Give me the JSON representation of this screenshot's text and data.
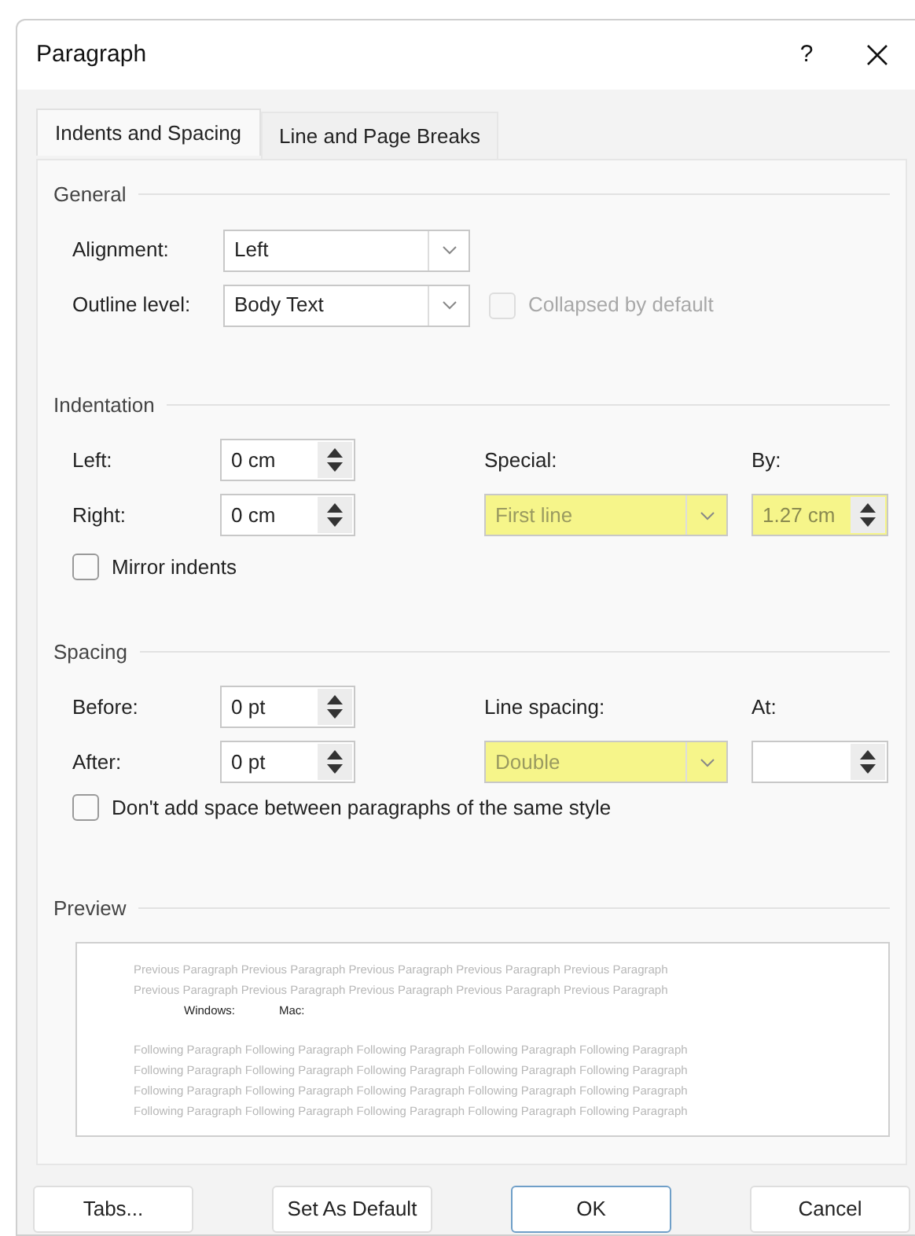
{
  "window": {
    "title": "Paragraph",
    "help": "?"
  },
  "tabs": [
    {
      "label": "Indents and Spacing",
      "selected": true
    },
    {
      "label": "Line and Page Breaks",
      "selected": false
    }
  ],
  "general": {
    "title": "General",
    "alignment": {
      "label": "Alignment:",
      "value": "Left"
    },
    "outline_level": {
      "label": "Outline level:",
      "value": "Body Text"
    },
    "collapsed": {
      "label": "Collapsed by default",
      "checked": false,
      "disabled": true
    }
  },
  "indentation": {
    "title": "Indentation",
    "left": {
      "label": "Left:",
      "value": "0 cm"
    },
    "right": {
      "label": "Right:",
      "value": "0 cm"
    },
    "special": {
      "label": "Special:",
      "value": "First line",
      "highlighted": true
    },
    "by": {
      "label": "By:",
      "value": "1.27 cm",
      "highlighted": true
    },
    "mirror": {
      "label": "Mirror indents",
      "checked": false
    }
  },
  "spacing": {
    "title": "Spacing",
    "before": {
      "label": "Before:",
      "value": "0 pt"
    },
    "after": {
      "label": "After:",
      "value": "0 pt"
    },
    "line_spacing": {
      "label": "Line spacing:",
      "value": "Double",
      "highlighted": true
    },
    "at": {
      "label": "At:",
      "highlighted": false
    },
    "dont_add": {
      "label": "Don't add space between paragraphs of the same style",
      "checked": false
    }
  },
  "preview": {
    "title": "Preview",
    "previous": [
      "Previous Paragraph Previous Paragraph Previous Paragraph Previous Paragraph Previous Paragraph",
      "Previous Paragraph Previous Paragraph Previous Paragraph Previous Paragraph Previous Paragraph"
    ],
    "sample": [
      "Windows:",
      "Mac:"
    ],
    "following": [
      "Following Paragraph Following Paragraph Following Paragraph Following Paragraph Following Paragraph",
      "Following Paragraph Following Paragraph Following Paragraph Following Paragraph Following Paragraph",
      "Following Paragraph Following Paragraph Following Paragraph Following Paragraph Following Paragraph",
      "Following Paragraph Following Paragraph Following Paragraph Following Paragraph Following Paragraph"
    ]
  },
  "buttons": [
    {
      "label": "Tabs...",
      "default": false
    },
    {
      "label": "Set As Default",
      "default": false
    },
    {
      "label": "OK",
      "default": true
    },
    {
      "label": "Cancel",
      "default": false
    }
  ]
}
